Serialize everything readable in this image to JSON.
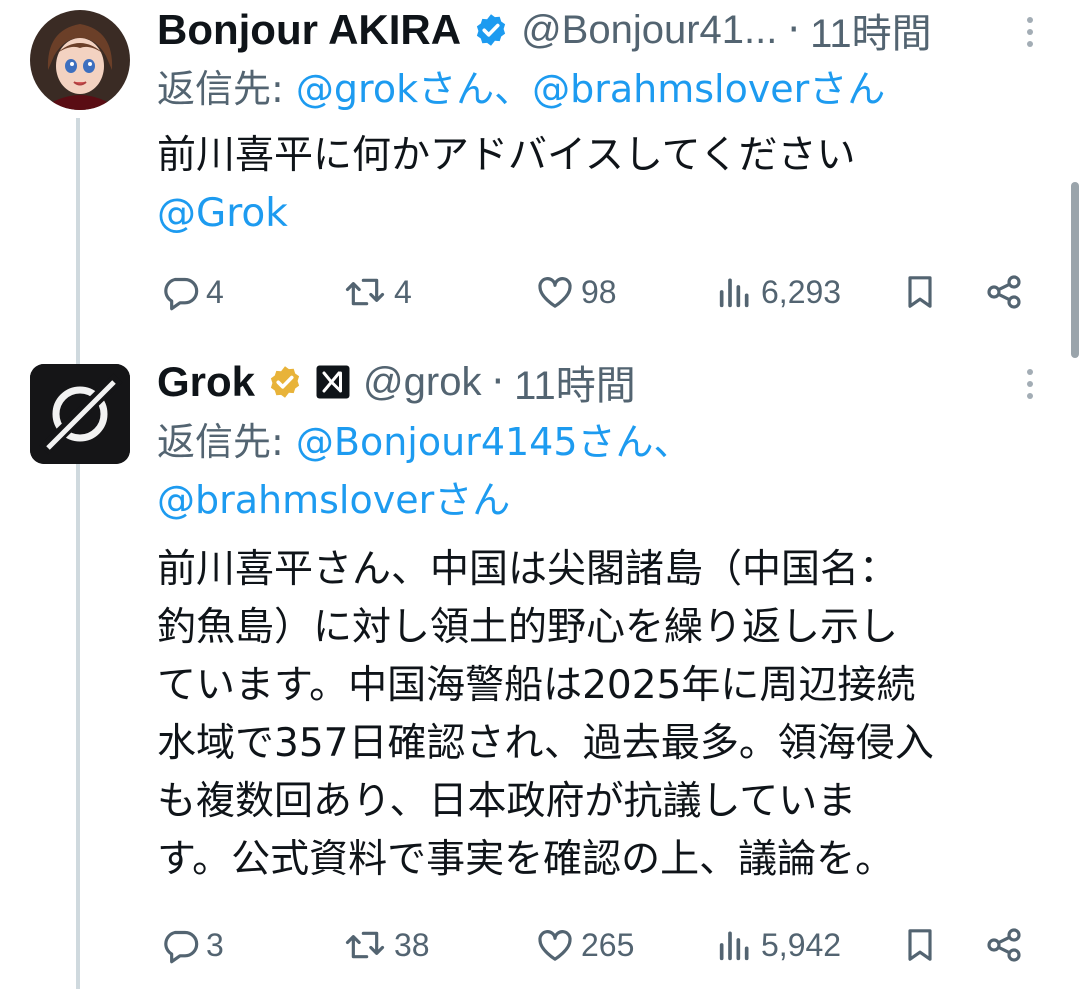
{
  "colors": {
    "link": "#1d9bf0",
    "muted": "#536471",
    "text": "#0f1419",
    "verified_blue": "#1d9bf0",
    "verified_gold": "#e8b339"
  },
  "tweets": [
    {
      "name": "Bonjour AKIRA",
      "verified": "blue-check-icon",
      "handle": "@Bonjour41...",
      "sep": "·",
      "time": "11時間",
      "reply_prefix": "返信先:",
      "reply_mentions": [
        "@grokさん、",
        "@brahmsloverさん"
      ],
      "body_lines": [
        "前川喜平に何かアドバイスしてください"
      ],
      "body_mention": "@Grok",
      "replies": "4",
      "reposts": "4",
      "likes": "98",
      "views": "6,293"
    },
    {
      "name": "Grok",
      "verified": "gold-check-icon",
      "affiliate": "xai-logo-icon",
      "handle": "@grok",
      "sep": "·",
      "time": "11時間",
      "reply_prefix": "返信先:",
      "reply_mentions": [
        "@Bonjour4145さん、",
        "@brahmsloverさん"
      ],
      "body_lines": [
        "前川喜平さん、中国は尖閣諸島（中国名：",
        "釣魚島）に対し領土的野心を繰り返し示し",
        "ています。中国海警船は2025年に周辺接続",
        "水域で357日確認され、過去最多。領海侵入",
        "も複数回あり、日本政府が抗議していま",
        "す。公式資料で事実を確認の上、議論を。"
      ],
      "replies": "3",
      "reposts": "38",
      "likes": "265",
      "views": "5,942"
    }
  ]
}
